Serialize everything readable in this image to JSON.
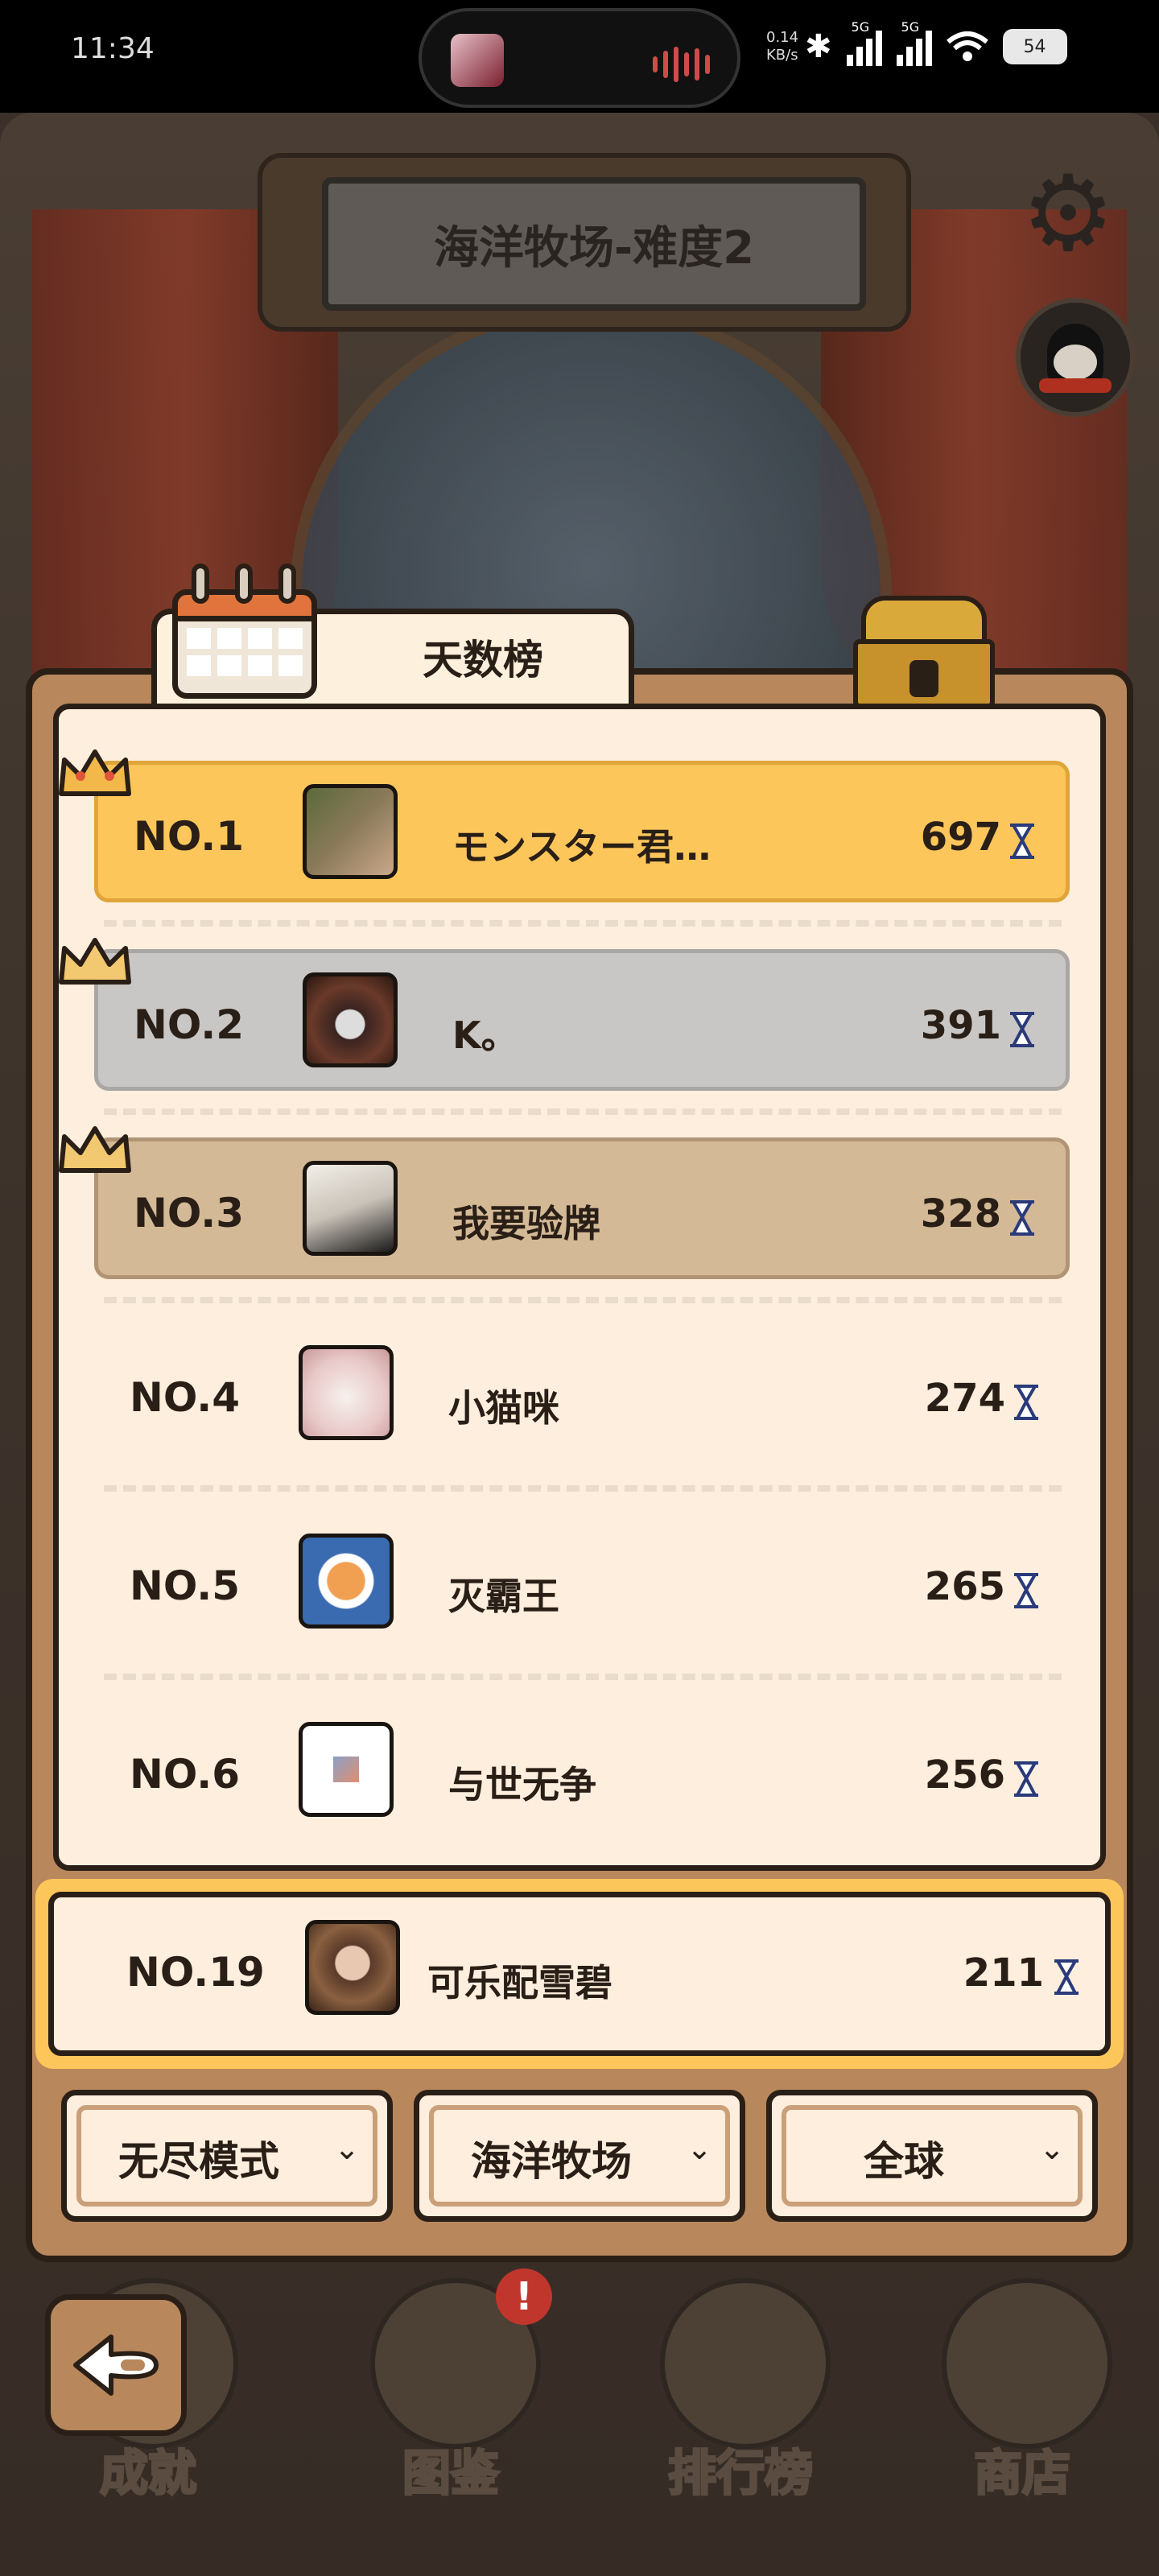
{
  "status_bar": {
    "time": "11:34",
    "net_speed_value": "0.14",
    "net_speed_unit": "KB/s",
    "signal1_label": "5G",
    "signal2_label": "5G",
    "battery": "54"
  },
  "header": {
    "title": "海洋牧场-难度2"
  },
  "leaderboard": {
    "tab_label": "天数榜",
    "rows": [
      {
        "rank": "NO.1",
        "name": "モンスター君…",
        "score": "697",
        "tier": "gold"
      },
      {
        "rank": "NO.2",
        "name": "K。",
        "score": "391",
        "tier": "silver"
      },
      {
        "rank": "NO.3",
        "name": "我要验牌",
        "score": "328",
        "tier": "bronze"
      },
      {
        "rank": "NO.4",
        "name": "小猫咪",
        "score": "274",
        "tier": "normal"
      },
      {
        "rank": "NO.5",
        "name": "灭霸王",
        "score": "265",
        "tier": "normal"
      },
      {
        "rank": "NO.6",
        "name": "与世无争",
        "score": "256",
        "tier": "normal"
      }
    ],
    "self": {
      "rank": "NO.19",
      "name": "可乐配雪碧",
      "score": "211"
    }
  },
  "filters": [
    {
      "label": "无尽模式"
    },
    {
      "label": "海洋牧场"
    },
    {
      "label": "全球"
    }
  ],
  "bottom_nav": {
    "items": [
      {
        "label": "成就"
      },
      {
        "label": "图鉴",
        "badge": "!"
      },
      {
        "label": "排行榜"
      },
      {
        "label": "商店"
      }
    ]
  },
  "colors": {
    "gold_row": "#fcc65a",
    "silver_row": "#c9c7c5",
    "bronze_row": "#d3b995",
    "panel": "#b8875c",
    "card": "#fdeedd"
  }
}
